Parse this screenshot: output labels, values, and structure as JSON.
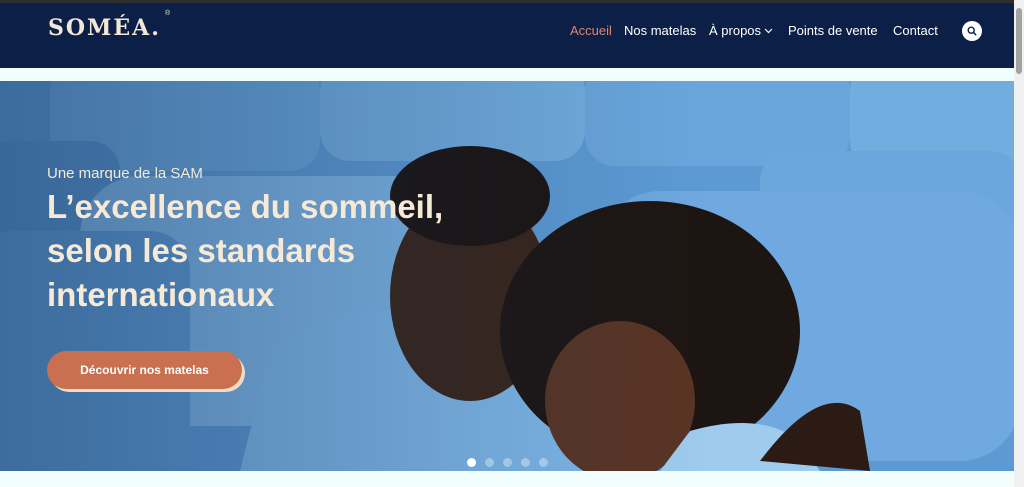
{
  "header": {
    "logo": "SOMÉA.",
    "logo_mark": "®",
    "nav": [
      {
        "label": "Accueil",
        "active": true
      },
      {
        "label": "Nos matelas"
      },
      {
        "label": "À propos",
        "has_dropdown": true
      },
      {
        "label": "Points de vente"
      },
      {
        "label": "Contact"
      }
    ],
    "search_icon": "search-icon",
    "dropdown_icon": "chevron-down-icon"
  },
  "hero": {
    "tagline": "Une marque de la SAM",
    "headline_lines": [
      "L’excellence du sommeil,",
      "selon les standards",
      "internationaux"
    ],
    "cta_label": "Découvrir nos matelas",
    "slider": {
      "total": 5,
      "active_index": 0
    }
  },
  "colors": {
    "header_bg": "#0c1f47",
    "accent": "#e8826a",
    "cta_bg": "#c8704f",
    "headline": "#f6ead6"
  }
}
